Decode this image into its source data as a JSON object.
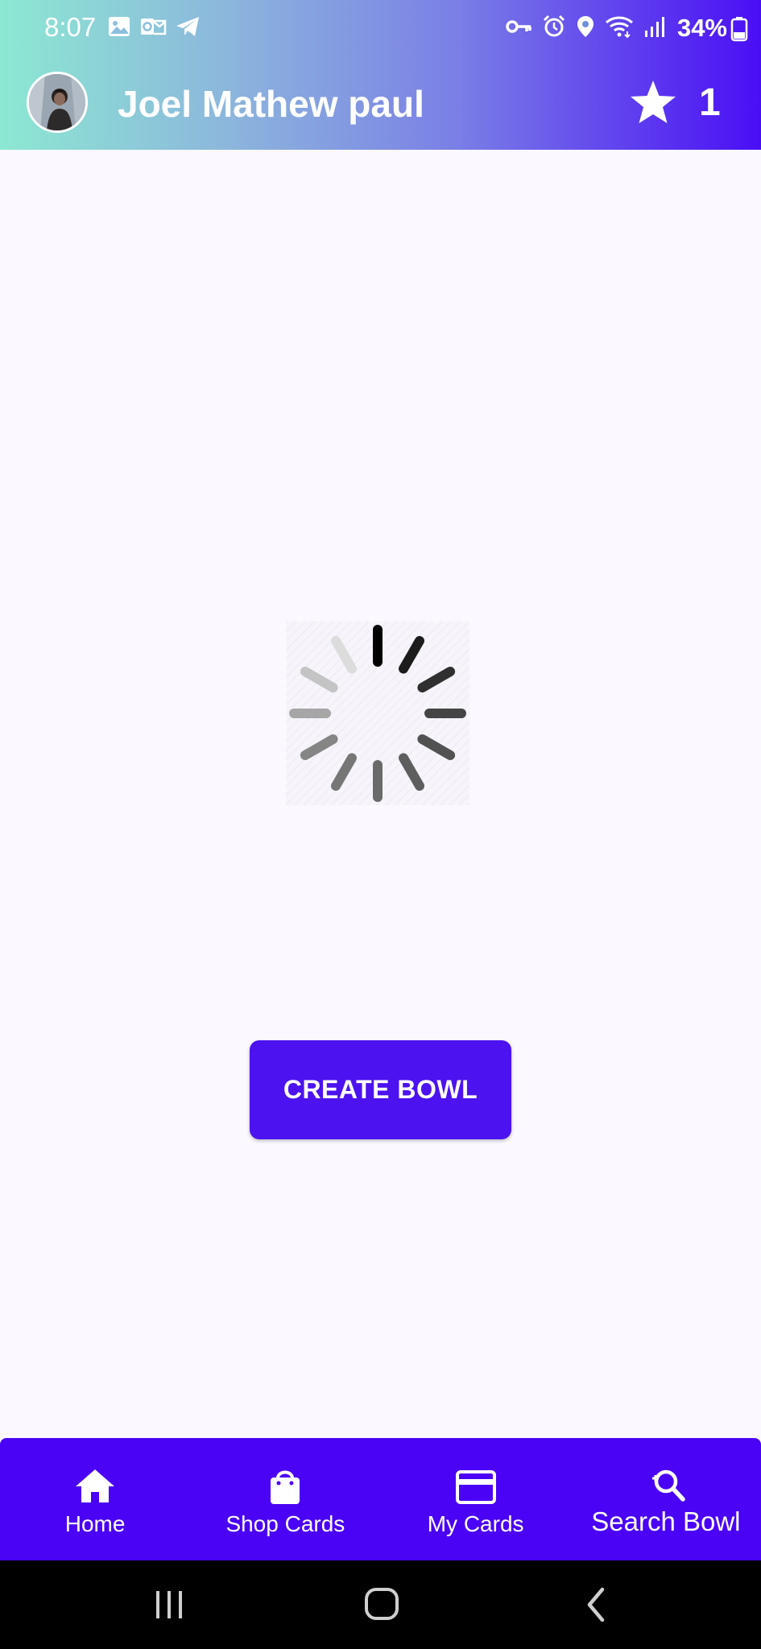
{
  "status_bar": {
    "time": "8:07",
    "battery": "34%",
    "left_icons": [
      "gallery-icon",
      "outlook-icon",
      "telegram-icon"
    ],
    "right_icons": [
      "vpn-key-icon",
      "alarm-icon",
      "location-icon",
      "wifi-icon",
      "signal-icon"
    ]
  },
  "app_bar": {
    "user_name": "Joel Mathew paul",
    "star_count": "1"
  },
  "main": {
    "create_button_label": "CREATE BOWL"
  },
  "bottom_nav": {
    "items": [
      {
        "label": "Home",
        "icon": "home-icon"
      },
      {
        "label": "Shop Cards",
        "icon": "shopping-bag-icon"
      },
      {
        "label": "My Cards",
        "icon": "credit-card-icon"
      },
      {
        "label": "Search Bowl",
        "icon": "search-icon"
      }
    ]
  },
  "colors": {
    "primary": "#4c12f0",
    "nav_background": "#4a03f5",
    "page_background": "#fbf8ff",
    "header_gradient_start": "#8ce8d2",
    "header_gradient_end": "#4a0ef5"
  }
}
